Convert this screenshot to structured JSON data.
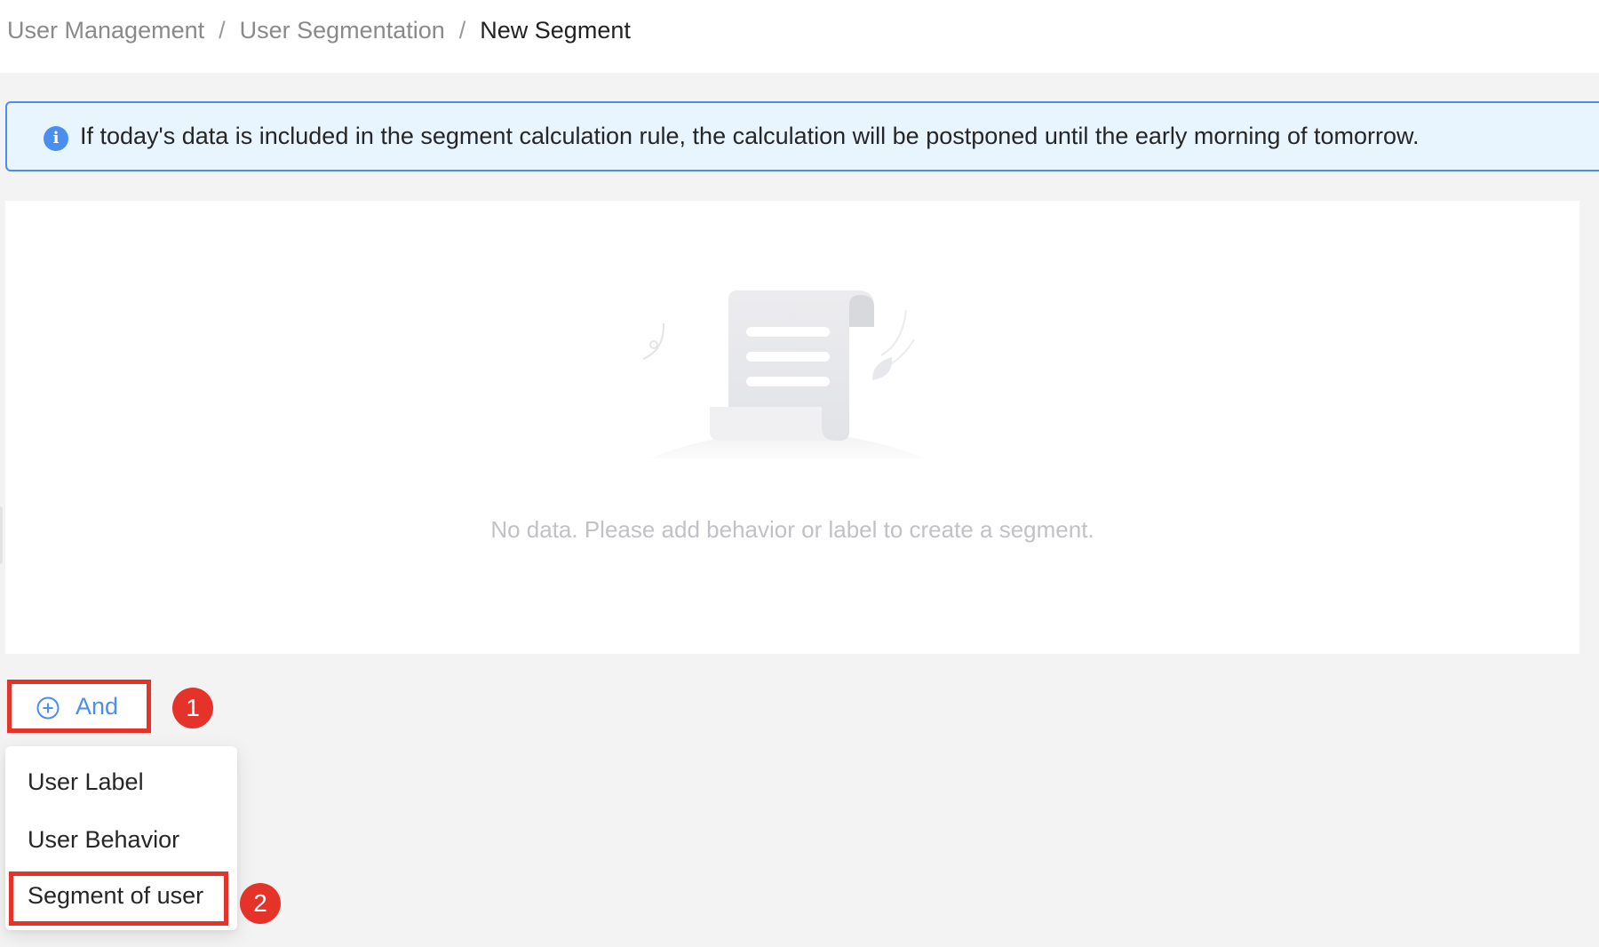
{
  "breadcrumb": {
    "items": [
      "User Management",
      "User Segmentation",
      "New Segment"
    ],
    "separator": "/"
  },
  "alert": {
    "icon": "info-icon",
    "icon_glyph": "i",
    "text": "If today's data is included in the segment calculation rule, the calculation will be postponed until the early morning of tomorrow."
  },
  "empty_state": {
    "icon": "empty-scroll-illustration",
    "text": "No data. Please add behavior or label to create a segment."
  },
  "add_button": {
    "icon": "plus-circle-icon",
    "label": "And"
  },
  "dropdown": {
    "items": [
      "User Label",
      "User Behavior",
      "Segment of user"
    ]
  },
  "annotations": {
    "step_1": "1",
    "step_2": "2"
  },
  "colors": {
    "accent": "#4a8ef0",
    "annotation_red": "#e6332a",
    "alert_bg": "#e8f4fe",
    "page_bg": "#f3f3f3"
  }
}
